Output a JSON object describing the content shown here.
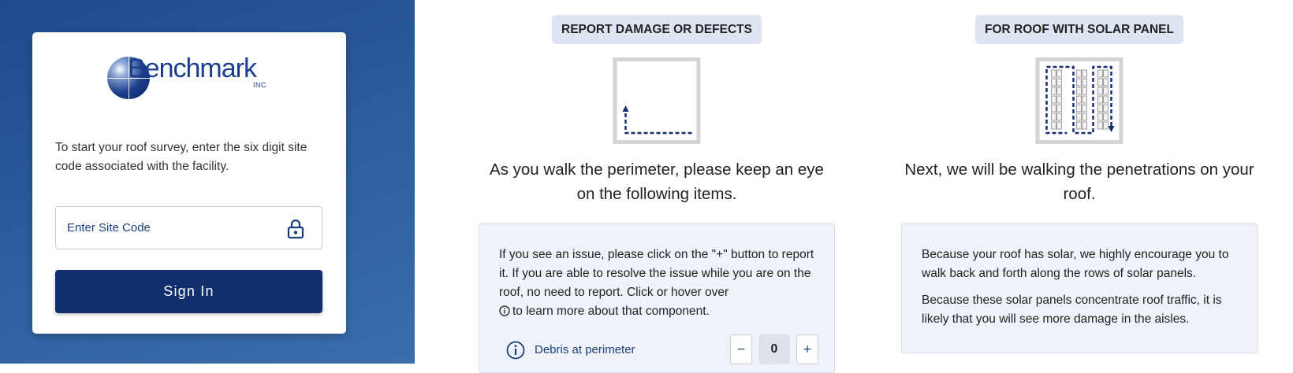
{
  "login": {
    "logo_text": "Benchmark",
    "logo_suffix": "INC",
    "intro": "To start your roof survey, enter the six digit site code associated with the facility.",
    "site_code_placeholder": "Enter Site Code",
    "sign_in_label": "Sign In",
    "icons": {
      "lock": "lock-icon"
    }
  },
  "damage": {
    "header": "REPORT DAMAGE OR DEFECTS",
    "lead": "As you walk the perimeter, please keep an eye on the following items.",
    "info_line1": "If you see an issue, please click on the \"+\" button to report it. If you are able to resolve the issue while you are on the roof, no need to report. Click or hover over",
    "info_line2": "to learn more about that component.",
    "item_label": "Debris at perimeter",
    "item_count": "0",
    "minus_label": "−",
    "plus_label": "+",
    "icons": {
      "info": "info-icon",
      "diagram": "perimeter-walk-diagram"
    }
  },
  "solar": {
    "header": "FOR ROOF WITH SOLAR PANEL",
    "lead": "Next, we will be walking the penetrations on your roof.",
    "paragraph1": "Because your roof has solar, we highly encourage you to walk back and forth along the rows of solar panels.",
    "paragraph2": "Because these solar panels concentrate roof traffic, it is likely that you will see more damage in the aisles.",
    "icons": {
      "diagram": "solar-walk-diagram"
    }
  },
  "colors": {
    "brand_navy": "#112e6e",
    "text_link_blue": "#1b3f7a",
    "header_badge_bg": "#dde4f2",
    "info_box_bg": "#eff2f8",
    "panel_gradient_top": "#1f4a8c",
    "panel_gradient_bottom": "#3a6eac"
  }
}
